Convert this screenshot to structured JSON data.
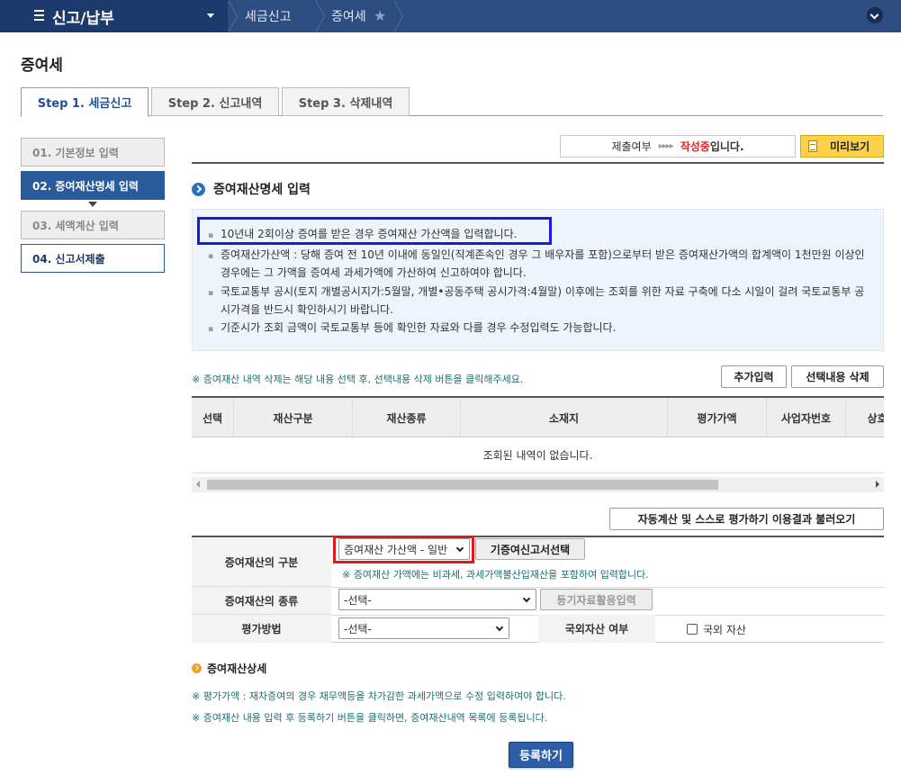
{
  "topbar": {
    "menu_label": "신고/납부",
    "crumb1": "세금신고",
    "crumb2": "증여세"
  },
  "page_title": "증여세",
  "step_tabs": [
    "Step 1. 세금신고",
    "Step 2. 신고내역",
    "Step 3. 삭제내역"
  ],
  "left_steps": [
    "01. 기본정보 입력",
    "02. 증여재산명세 입력",
    "03. 세액계산 입력",
    "04. 신고서제출"
  ],
  "status": {
    "label": "제출여부",
    "arrows": "▸▸▸▸",
    "state_red": "작성중",
    "state_suffix": "입니다.",
    "preview_label": "미리보기"
  },
  "section_title": "증여재산명세 입력",
  "notice": [
    "10년내 2회이상 증여를 받은 경우 증여재산 가산액을 입력합니다.",
    "증여재산가산액 : 당해 증여 전 10년 이내에 동일인(직계존속인 경우 그 배우자를 포함)으로부터 받은 증여재산가액의 합계액이 1천만원 이상인 경우에는 그 가액을 증여세 과세가액에 가산하여 신고하여야 합니다.",
    "국토교통부 공시(토지 개별공시지가:5월말, 개별•공동주택 공시가격:4월말) 이후에는 조회를 위한 자료 구축에 다소 시일이 걸려 국토교통부 공시가격을 반드시 확인하시기 바랍니다.",
    "기준시가 조회 금액이 국토교통부 등에 확인한 자료와 다를 경우 수정입력도 가능합니다."
  ],
  "table": {
    "note": "※ 증여재산 내역 삭제는 해당 내용 선택 후, 선택내용 삭제 버튼을  클릭해주세요.",
    "add_btn": "추가입력",
    "delete_btn": "선택내용 삭제",
    "headers": [
      "선택",
      "재산구분",
      "재산종류",
      "소재지",
      "평가가액",
      "사업자번호",
      "상호"
    ],
    "empty_text": "조회된 내역이 없습니다."
  },
  "form": {
    "autocalc_btn": "자동계산 및 스스로 평가하기 이용결과 불러오기",
    "row1_label": "증여재산의 구분",
    "row1_value": "증여재산 가산액 - 일반",
    "row1_btn": "기증여신고서선택",
    "row1_note": "※ 증여재산 가액에는 비과세, 과세가액불산입재산을 포함하여 입력합니다.",
    "row2_label": "증여재산의 종류",
    "row2_value": "-선택-",
    "row2_btn": "등기자료활용입력",
    "row3_label": "평가방법",
    "row3_value": "-선택-",
    "row3_label2": "국외자산 여부",
    "row3_check": "국외 자산"
  },
  "detail": {
    "title": "증여재산상세",
    "note1": "※ 평가가액 : 재차증여의 경우 채무액등을 차가감한 과세가액으로 수정 입력하여야 합니다.",
    "note2": "※ 증여재산 내용 입력 후 등록하기 버튼을 클릭하면, 증여재산내역 목록에 등록됩니다.",
    "submit": "등록하기"
  }
}
